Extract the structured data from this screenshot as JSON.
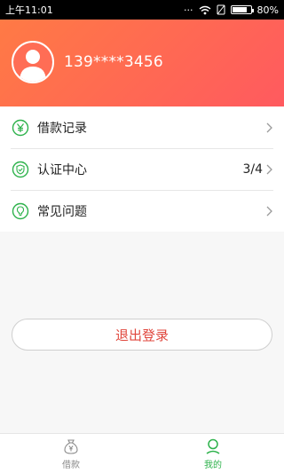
{
  "status_bar": {
    "time": "上午11:01",
    "battery": "80%",
    "battery_level": 0.8
  },
  "profile": {
    "phone": "139****3456"
  },
  "menu": {
    "items": [
      {
        "label": "借款记录",
        "value": "",
        "icon": "yen-circle-icon"
      },
      {
        "label": "认证中心",
        "value": "3/4",
        "icon": "shield-check-icon"
      },
      {
        "label": "常见问题",
        "value": "",
        "icon": "lightbulb-icon"
      }
    ]
  },
  "logout_label": "退出登录",
  "tabs": [
    {
      "label": "借款",
      "icon": "money-bag-icon",
      "active": false
    },
    {
      "label": "我的",
      "icon": "user-icon",
      "active": true
    }
  ],
  "colors": {
    "header_gradient_start": "#ff7a45",
    "header_gradient_end": "#ff5a5f",
    "accent_green": "#2db24b",
    "logout_red": "#e0473d"
  }
}
